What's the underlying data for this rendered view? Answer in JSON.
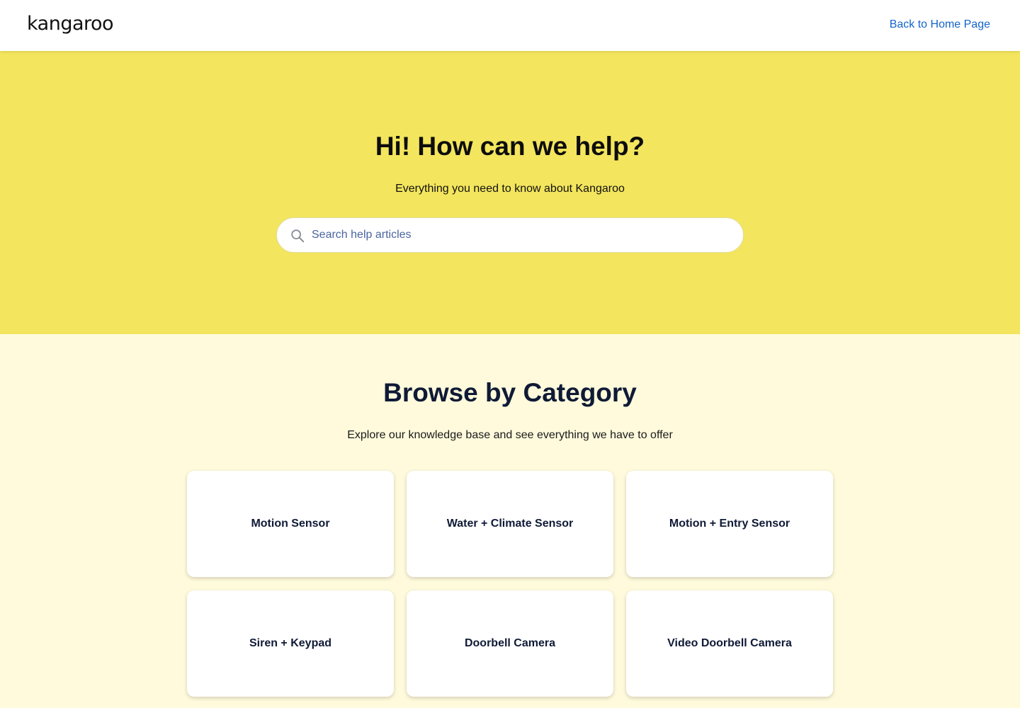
{
  "header": {
    "logo_text": "kangaroo",
    "home_link": "Back to Home Page"
  },
  "hero": {
    "title": "Hi! How can we help?",
    "subtitle": "Everything you need to know about Kangaroo",
    "search": {
      "placeholder": "Search help articles",
      "value": "",
      "icon": "search-icon"
    }
  },
  "browse": {
    "title": "Browse by Category",
    "subtitle": "Explore our knowledge base and see everything we have to offer",
    "categories": [
      {
        "label": "Motion Sensor"
      },
      {
        "label": "Water + Climate Sensor"
      },
      {
        "label": "Motion + Entry Sensor"
      },
      {
        "label": "Siren + Keypad"
      },
      {
        "label": "Doorbell Camera"
      },
      {
        "label": "Video Doorbell Camera"
      }
    ]
  },
  "colors": {
    "hero_background": "#f3e55d",
    "page_background": "#fffadc",
    "link": "#1464c8",
    "heading_navy": "#0f1a36"
  }
}
